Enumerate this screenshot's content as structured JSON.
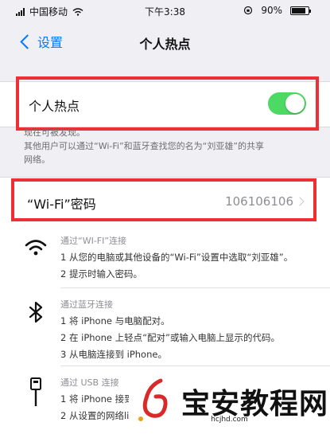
{
  "status_bar": {
    "carrier": "中国移动",
    "time": "下午3:38",
    "battery": "90%"
  },
  "nav": {
    "back_label": "设置",
    "title": "个人热点"
  },
  "hotspot": {
    "label": "个人热点",
    "enabled": true
  },
  "description": {
    "line1": "现在可被发现。",
    "line2": "其他用户可以通过“Wi-Fi”和蓝牙查找您的名为“刘亚雄”的共享",
    "line3": "网络。"
  },
  "wifi_password": {
    "label": "“Wi-Fi”密码",
    "value": "106106106"
  },
  "guide_wifi": {
    "heading": "通过“WI-FI”连接",
    "step1": "1 从您的电脑或其他设备的“Wi-Fi”设置中选取“刘亚雄”。",
    "step2": "2 提示时输入密码。"
  },
  "guide_bluetooth": {
    "heading": "通过蓝牙连接",
    "step1": "1 将 iPhone 与电脑配对。",
    "step2": "2 在 iPhone 上轻点“配对”或输入电脑上显示的代码。",
    "step3": "3 从电脑连接到 iPhone。"
  },
  "guide_usb": {
    "heading": "通过 USB 连接",
    "step1": "1 将 iPhone 接到",
    "step2": "2 从设置的网络likely"
  },
  "watermark": {
    "text": "宝安教程网",
    "url": "hcjhd.com"
  },
  "colors": {
    "accent": "#007aff",
    "toggle_on": "#4cd964",
    "highlight": "#ee2f35"
  }
}
